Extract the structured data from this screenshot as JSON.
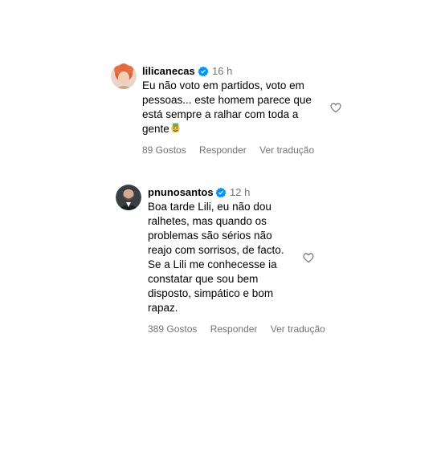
{
  "comments": [
    {
      "username": "lilicanecas",
      "time": "16 h",
      "lines": [
        "Eu não voto em partidos, voto em",
        "pessoas... este homem parece que",
        "está sempre a ralhar com toda a",
        "gente"
      ],
      "likes": "89 Gostos",
      "reply": "Responder",
      "translate": "Ver tradução",
      "emoji": "zany-face"
    },
    {
      "username": "pnunosantos",
      "time": "12 h",
      "lines": [
        "Boa tarde Lili, eu não dou",
        "ralhetes, mas quando os",
        "problemas são sérios não",
        "reajo com sorrisos, de facto.",
        "Se a Lili me conhecesse ia",
        "constatar que sou bem",
        "disposto, simpático e bom",
        "rapaz."
      ],
      "likes": "389 Gostos",
      "reply": "Responder",
      "translate": "Ver tradução"
    }
  ],
  "colors": {
    "verified": "#0095f6",
    "secondary": "#737373"
  },
  "icons": {
    "verified": "verified-badge-icon",
    "like": "heart-outline-icon"
  }
}
